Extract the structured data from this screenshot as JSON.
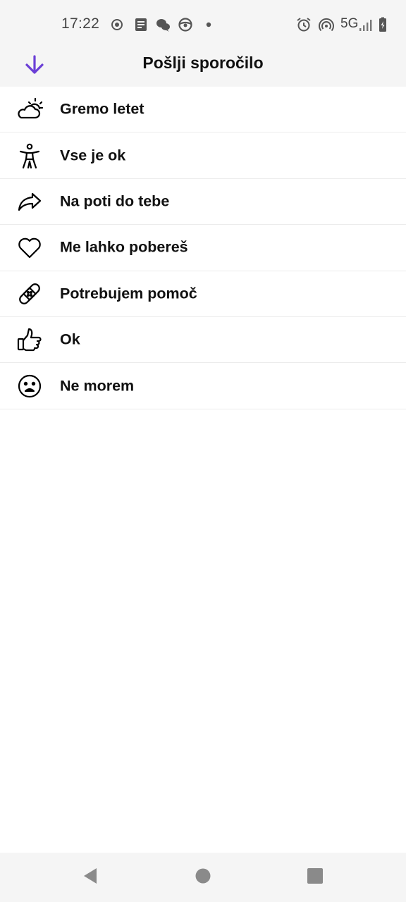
{
  "status_bar": {
    "time": "17:22",
    "network": "5G",
    "icons": [
      "record-icon",
      "notes-icon",
      "chat-icon",
      "steering-wheel-icon",
      "dot-icon",
      "alarm-icon",
      "hotspot-icon",
      "signal-icon",
      "battery-charging-icon"
    ]
  },
  "header": {
    "title": "Pošlji sporočilo",
    "back_icon": "arrow-down-icon",
    "accent_color": "#6b3fd6"
  },
  "messages": [
    {
      "label": "Gremo letet",
      "icon": "partly-cloudy-icon"
    },
    {
      "label": "Vse je ok",
      "icon": "accessibility-person-icon"
    },
    {
      "label": "Na poti do tebe",
      "icon": "share-arrow-icon"
    },
    {
      "label": "Me lahko pobereš",
      "icon": "heart-icon"
    },
    {
      "label": "Potrebujem pomoč",
      "icon": "bandage-icon"
    },
    {
      "label": "Ok",
      "icon": "thumbs-up-icon"
    },
    {
      "label": "Ne morem",
      "icon": "sad-face-icon"
    }
  ],
  "nav_bar": {
    "icons": [
      "back-triangle-icon",
      "home-circle-icon",
      "recents-square-icon"
    ]
  }
}
